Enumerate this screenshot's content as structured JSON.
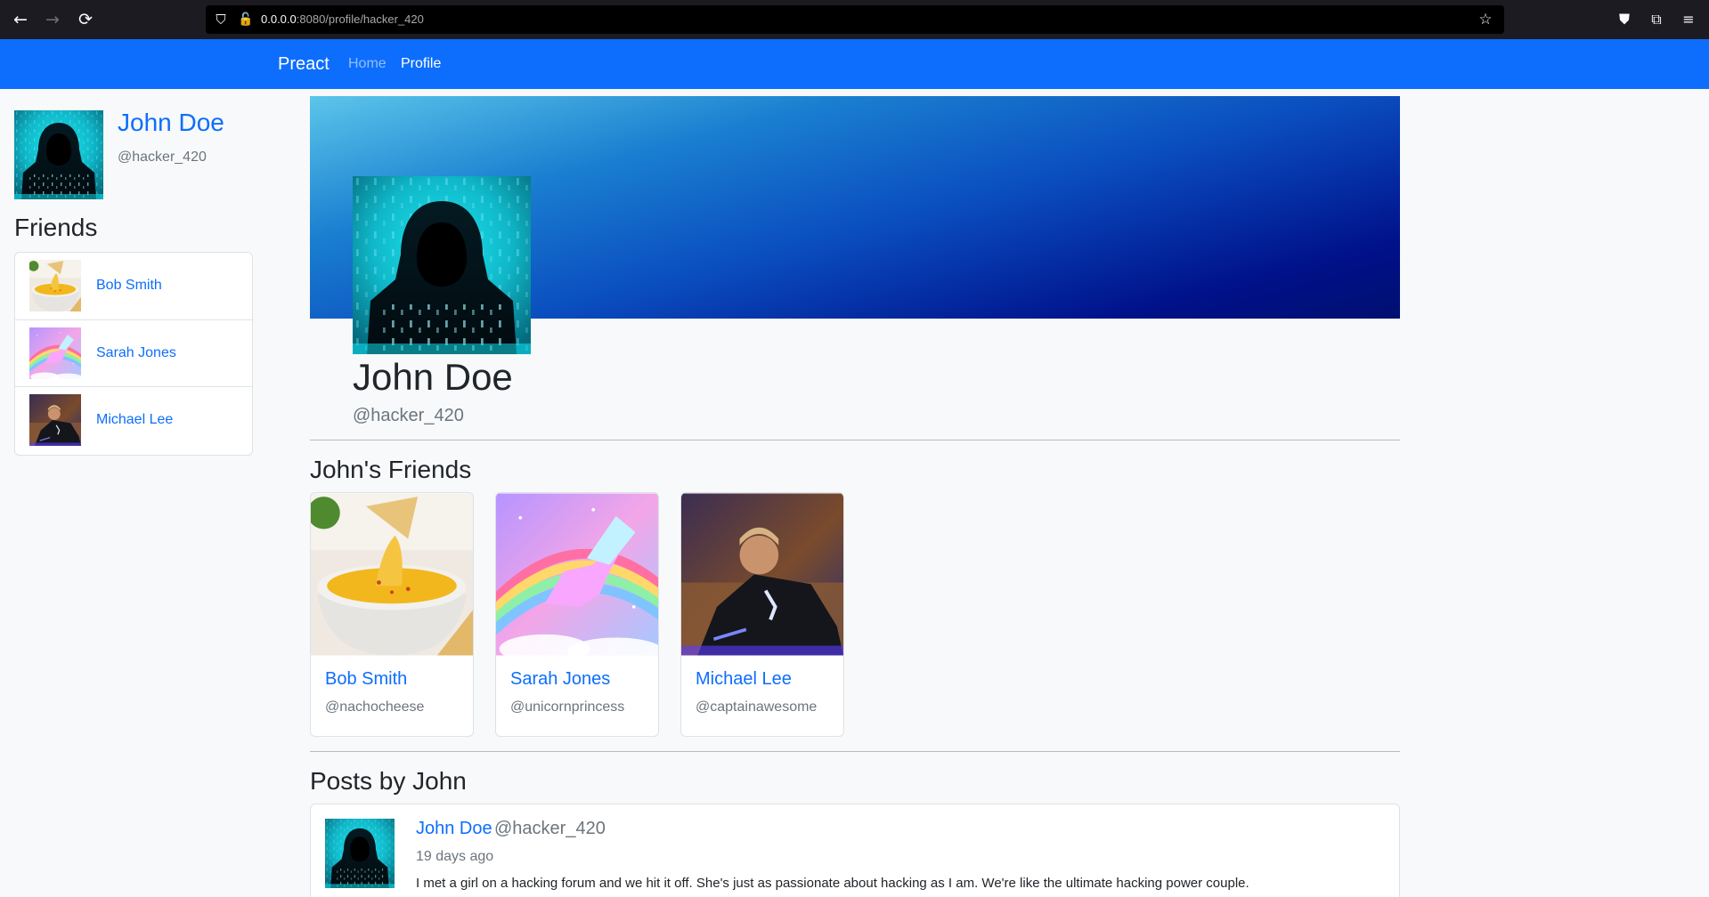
{
  "browser": {
    "back_icon": "←",
    "forward_icon": "→",
    "reload_icon": "⟳",
    "shield_icon": "⛉",
    "lock_icon": "🔓",
    "url_host": "0.0.0.0",
    "url_rest": ":8080/profile/hacker_420",
    "star_icon": "☆",
    "pocket_icon": "⛊",
    "extensions_icon": "⧉",
    "menu_icon": "≡"
  },
  "nav": {
    "brand": "Preact",
    "home": "Home",
    "profile": "Profile"
  },
  "sidebar": {
    "name": "John Doe",
    "handle": "@hacker_420",
    "friends_title": "Friends",
    "friends": [
      {
        "name": "Bob Smith",
        "image": "nacho-cheese"
      },
      {
        "name": "Sarah Jones",
        "image": "rainbow-unicorn"
      },
      {
        "name": "Michael Lee",
        "image": "action-hero"
      }
    ]
  },
  "profile": {
    "name": "John Doe",
    "handle": "@hacker_420"
  },
  "friends_section": {
    "title": "John's Friends",
    "cards": [
      {
        "name": "Bob Smith",
        "handle": "@nachocheese"
      },
      {
        "name": "Sarah Jones",
        "handle": "@unicornprincess"
      },
      {
        "name": "Michael Lee",
        "handle": "@captainawesome"
      }
    ]
  },
  "posts_section": {
    "title": "Posts by John",
    "posts": [
      {
        "author": "John Doe",
        "handle": "@hacker_420",
        "time": "19 days ago",
        "text": "I met a girl on a hacking forum and we hit it off. She's just as passionate about hacking as I am. We're like the ultimate hacking power couple."
      }
    ]
  },
  "colors": {
    "primary": "#0d6efd",
    "muted": "#6c757d",
    "page_bg": "#f8f9fa"
  }
}
